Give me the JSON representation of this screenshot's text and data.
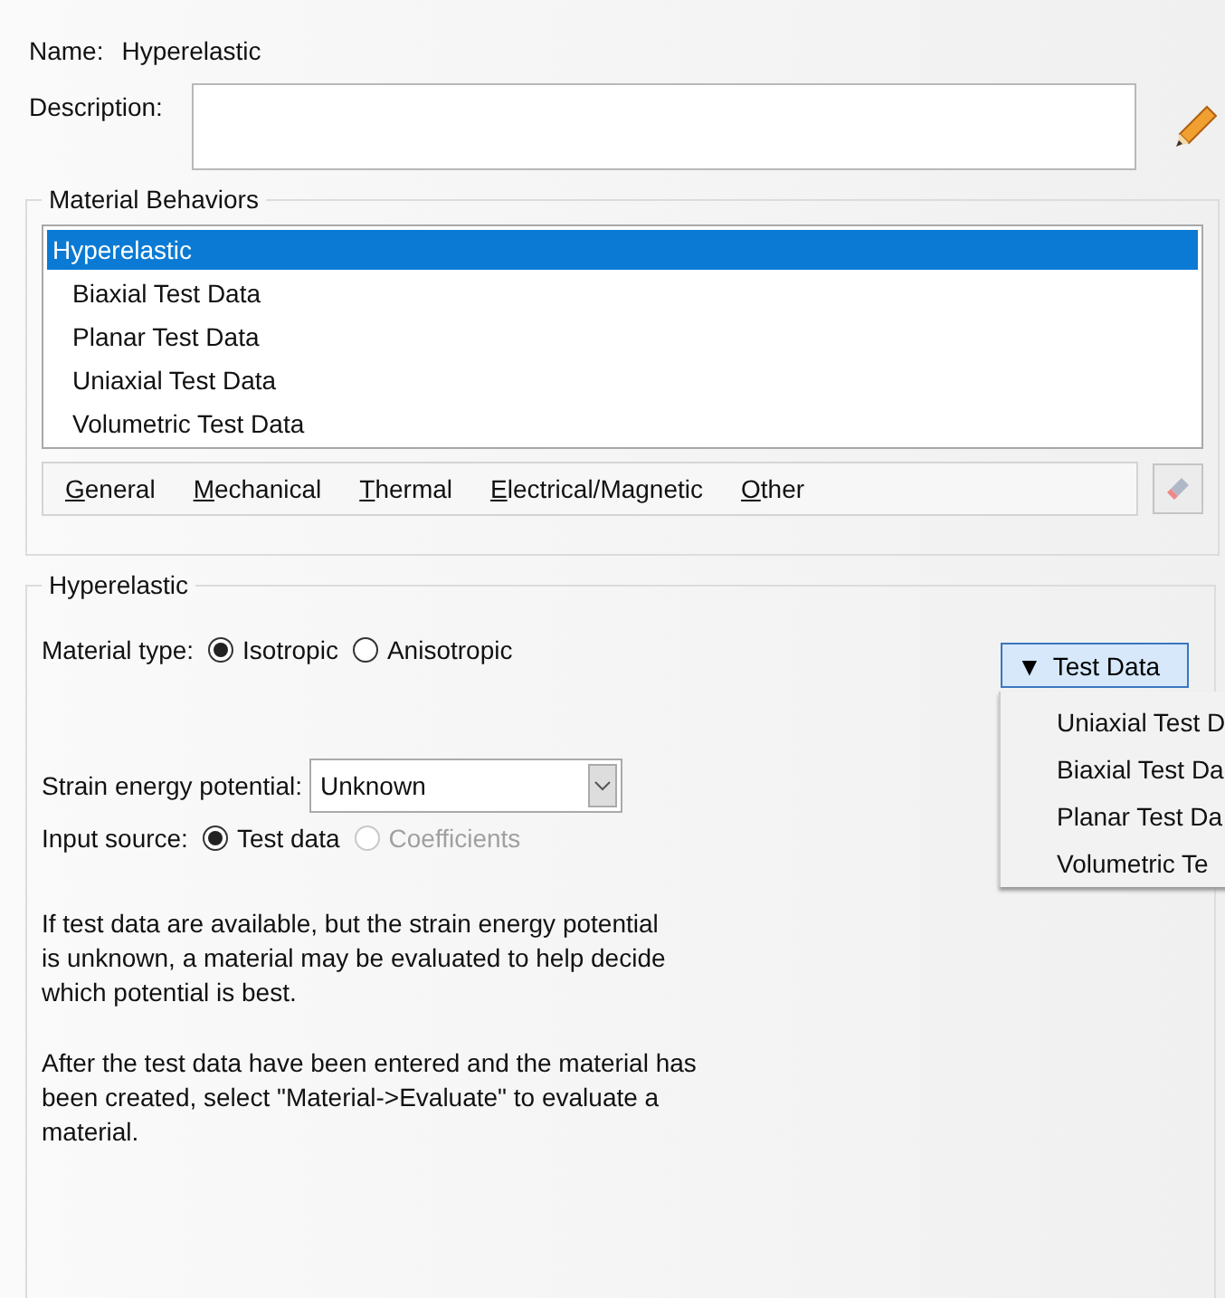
{
  "name": {
    "label": "Name:",
    "value": "Hyperelastic"
  },
  "description": {
    "label": "Description:"
  },
  "material_behaviors": {
    "title": "Material Behaviors",
    "items": [
      {
        "label": "Hyperelastic",
        "selected": true,
        "children": [
          {
            "label": "Biaxial Test Data",
            "selected": false
          },
          {
            "label": "Planar Test Data",
            "selected": false
          },
          {
            "label": "Uniaxial Test Data",
            "selected": false
          },
          {
            "label": "Volumetric Test Data",
            "selected": false
          }
        ]
      }
    ],
    "menus": [
      "General",
      "Mechanical",
      "Thermal",
      "Electrical/Magnetic",
      "Other"
    ]
  },
  "hyperelastic": {
    "title": "Hyperelastic",
    "material_type": {
      "label": "Material type:",
      "options": [
        {
          "label": "Isotropic",
          "selected": true,
          "disabled": false
        },
        {
          "label": "Anisotropic",
          "selected": false,
          "disabled": false
        }
      ]
    },
    "test_data_button": {
      "arrow": "▼",
      "label": "Test Data"
    },
    "test_data_menu": [
      "Uniaxial Test D",
      "Biaxial Test Da",
      "Planar Test Da",
      "Volumetric Te"
    ],
    "strain_energy_potential": {
      "label": "Strain energy potential:",
      "value": "Unknown"
    },
    "input_source": {
      "label": "Input source:",
      "options": [
        {
          "label": "Test data",
          "selected": true,
          "disabled": false
        },
        {
          "label": "Coefficients",
          "selected": false,
          "disabled": true
        }
      ]
    },
    "notes": [
      "If test data are available, but the strain energy potential\nis unknown, a material may be evaluated to help decide\nwhich potential is best.",
      "After the test data have been entered and the material has\nbeen created, select \"Material->Evaluate\" to evaluate a\nmaterial."
    ]
  }
}
